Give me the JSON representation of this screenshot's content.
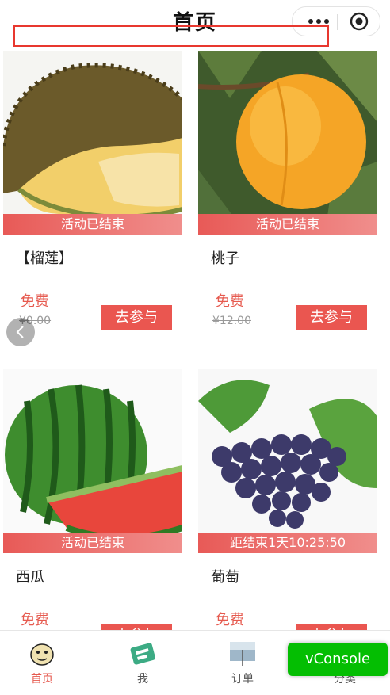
{
  "header": {
    "title": "首页"
  },
  "products": [
    {
      "name": "【榴莲】",
      "status": "活动已结束",
      "price_label": "免费",
      "original_price": "¥0.00",
      "button": "去参与",
      "image": "durian"
    },
    {
      "name": "桃子",
      "status": "活动已结束",
      "price_label": "免费",
      "original_price": "¥12.00",
      "button": "去参与",
      "image": "peach"
    },
    {
      "name": "西瓜",
      "status": "活动已结束",
      "price_label": "免费",
      "original_price": "",
      "button": "去参与",
      "image": "watermelon"
    },
    {
      "name": "葡萄",
      "status": "距结束1天10:25:50",
      "price_label": "免费",
      "original_price": "",
      "button": "去参与",
      "image": "grapes"
    }
  ],
  "tabs": [
    {
      "label": "首页",
      "icon": "home-cartoon-icon",
      "active": true
    },
    {
      "label": "我",
      "icon": "profile-icon",
      "active": false
    },
    {
      "label": "订单",
      "icon": "orders-icon",
      "active": false
    },
    {
      "label": "分类",
      "icon": "category-icon",
      "active": false
    }
  ],
  "vconsole": {
    "label": "vConsole"
  },
  "colors": {
    "accent": "#ea5650",
    "price": "#e65a4f",
    "vconsole": "#04be02"
  }
}
